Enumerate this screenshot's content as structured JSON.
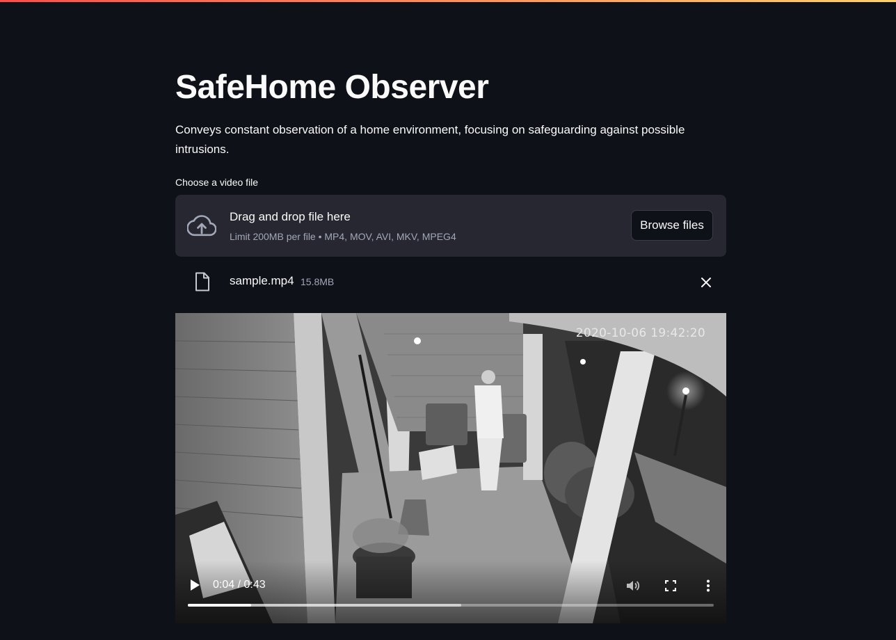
{
  "app": {
    "title": "SafeHome Observer",
    "description": "Conveys constant observation of a home environment, focusing on safeguarding against possible intrusions."
  },
  "uploader": {
    "label": "Choose a video file",
    "drop_title": "Drag and drop file here",
    "limit_text": "Limit 200MB per file • MP4, MOV, AVI, MKV, MPEG4",
    "browse_label": "Browse files",
    "icon": "cloud-upload-icon"
  },
  "uploaded_file": {
    "name": "sample.mp4",
    "size": "15.8MB",
    "icon": "file-icon",
    "remove_icon": "close-icon"
  },
  "video": {
    "timestamp_overlay": "2020-10-06 19:42:20",
    "time_display": "0:04 / 0:43",
    "played_fraction": 0.12,
    "buffered_fraction": 0.52
  },
  "colors": {
    "background": "#0e1117",
    "dropzone": "#262730",
    "accent_gradient_start": "#ff4b4b",
    "accent_gradient_end": "#ffd166",
    "muted_text": "#a3a8b8"
  }
}
